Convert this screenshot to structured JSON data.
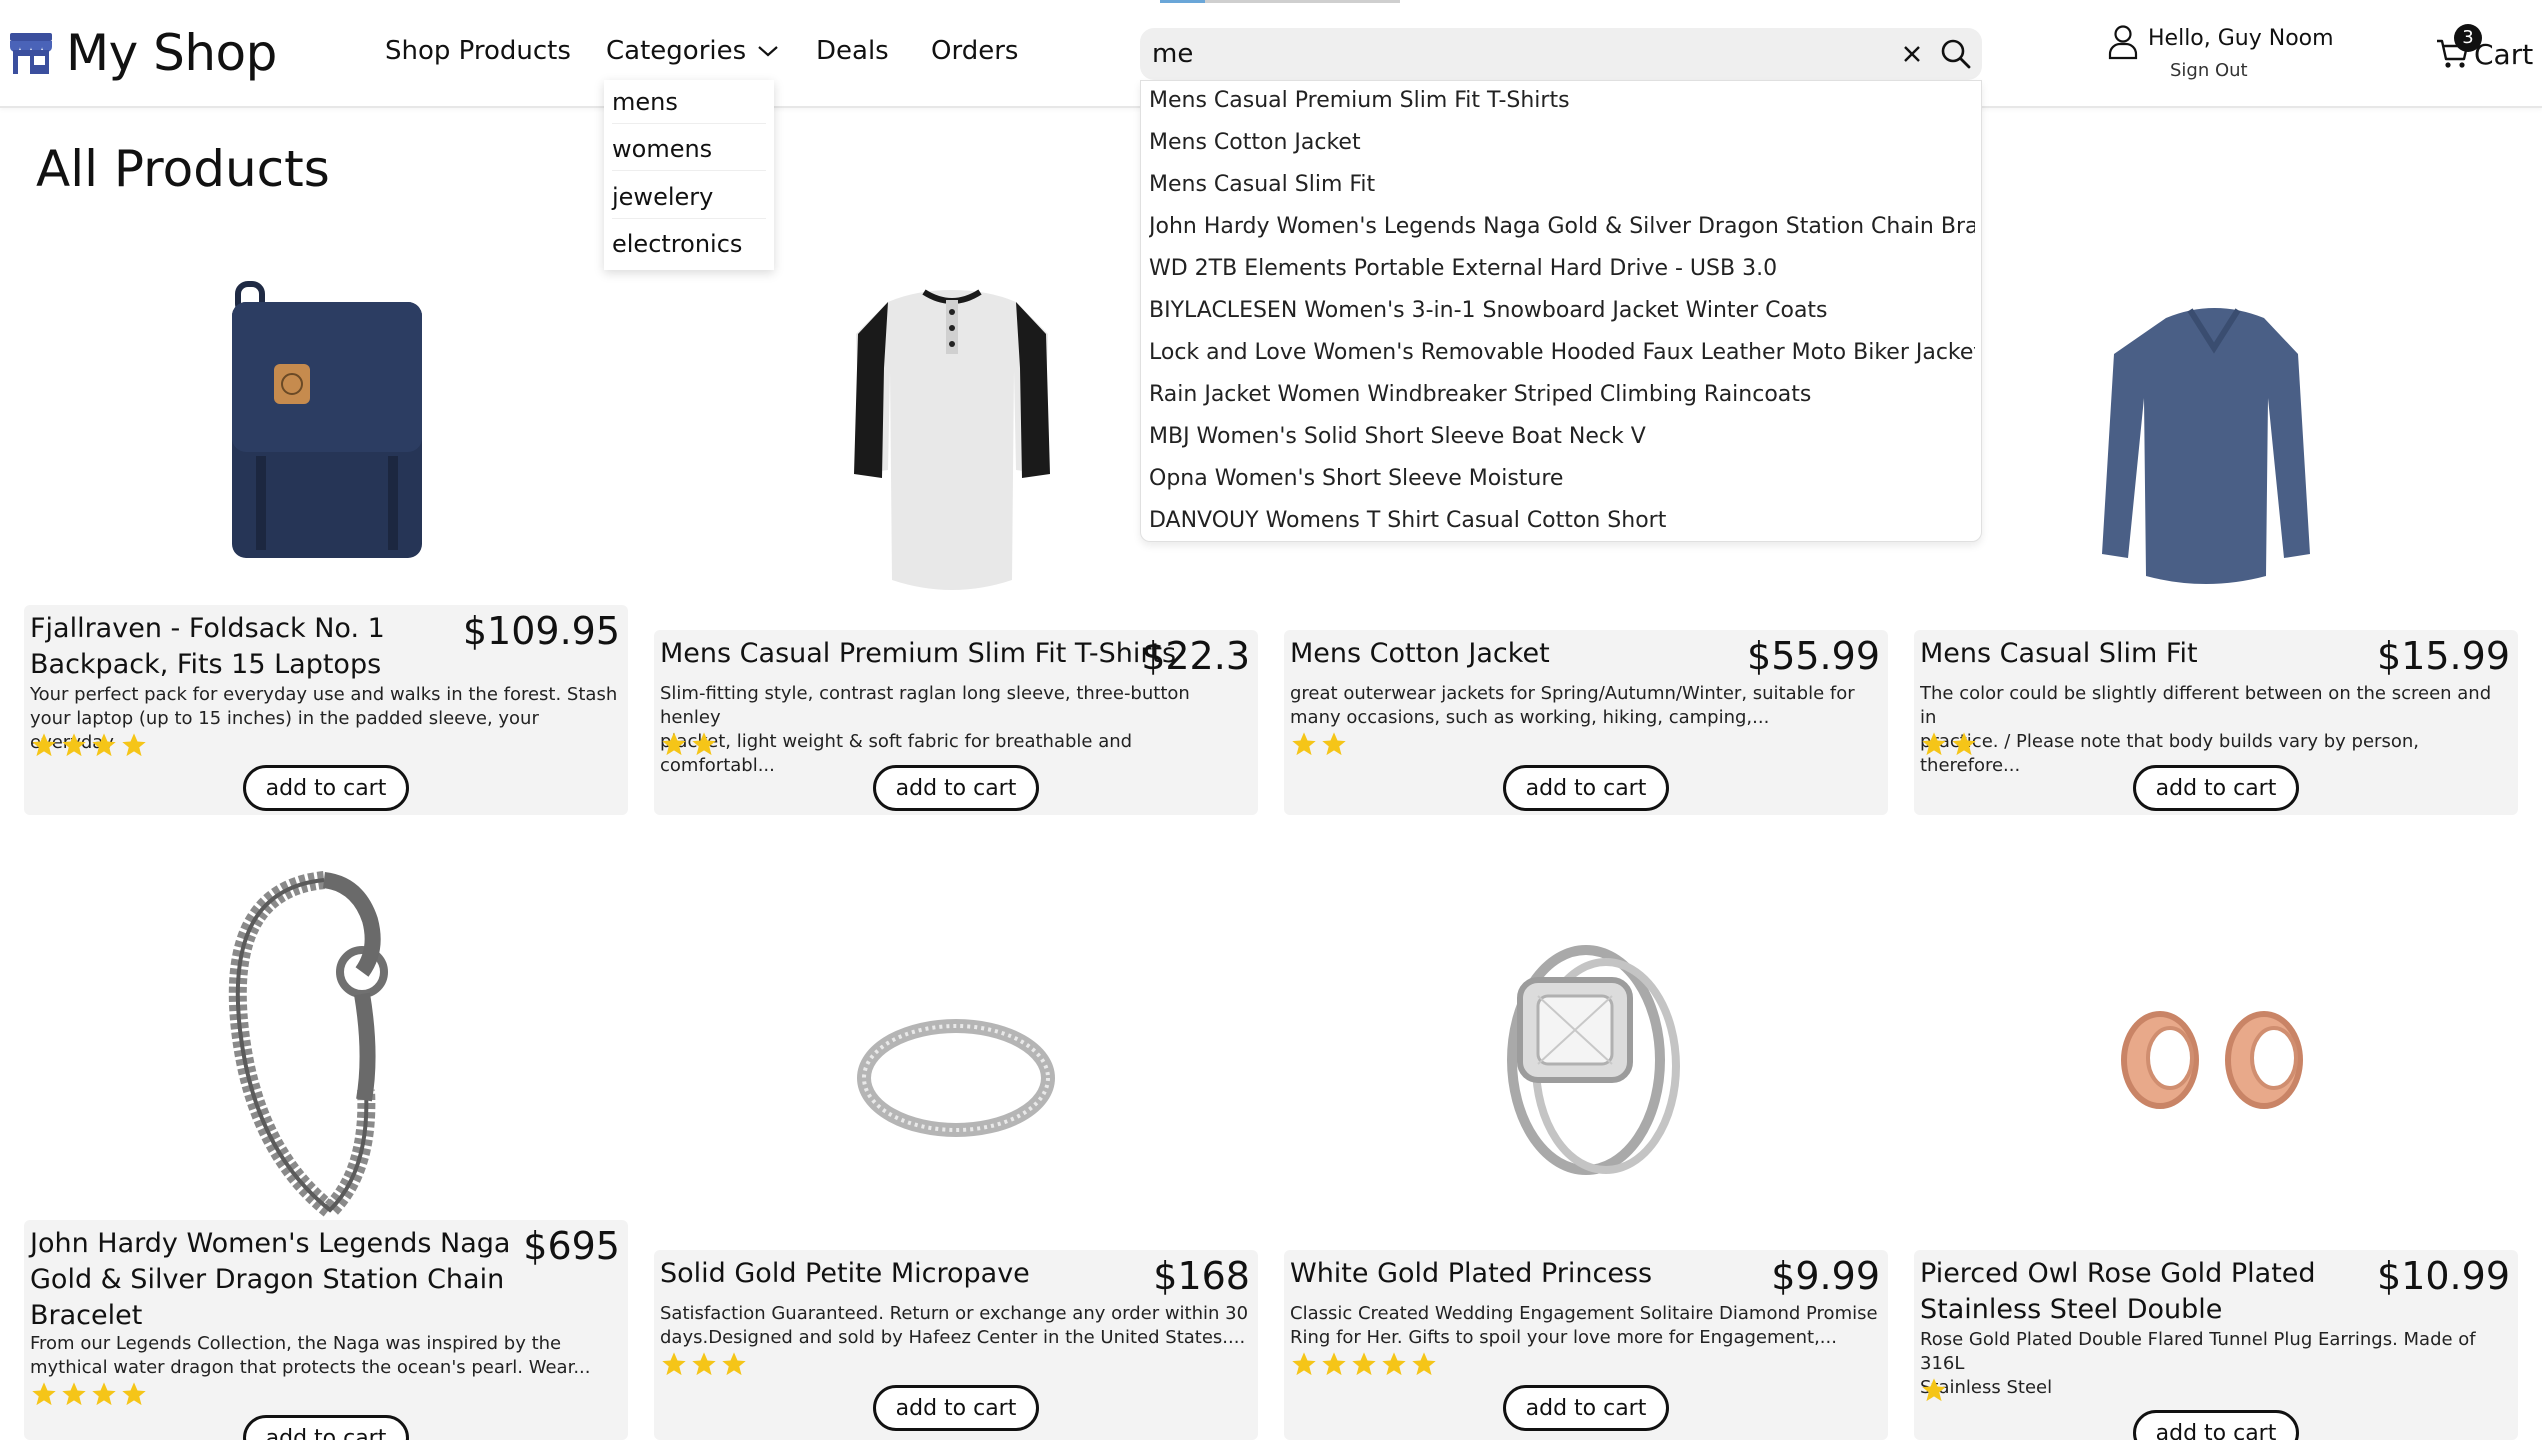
{
  "header": {
    "logo_text": "My Shop",
    "logo_icon": "storefront-icon",
    "nav": {
      "shop_products": "Shop Products",
      "categories": "Categories",
      "deals": "Deals",
      "orders": "Orders"
    },
    "search": {
      "value": "me",
      "suggestions": [
        "Mens Casual Premium Slim Fit T-Shirts",
        "Mens Cotton Jacket",
        "Mens Casual Slim Fit",
        "John Hardy Women's Legends Naga Gold & Silver Dragon Station Chain Brace...",
        "WD 2TB Elements Portable External Hard Drive - USB 3.0",
        "BIYLACLESEN Women's 3-in-1 Snowboard Jacket Winter Coats",
        "Lock and Love Women's Removable Hooded Faux Leather Moto Biker Jacket",
        "Rain Jacket Women Windbreaker Striped Climbing Raincoats",
        "MBJ Women's Solid Short Sleeve Boat Neck V",
        "Opna Women's Short Sleeve Moisture",
        "DANVOUY Womens T Shirt Casual Cotton Short"
      ]
    },
    "user": {
      "greeting": "Hello, Guy Noom",
      "sign_out": "Sign Out"
    },
    "cart": {
      "count": "3",
      "label": "Cart"
    },
    "categories_menu": [
      "mens",
      "womens",
      "jewelery",
      "electronics"
    ]
  },
  "main": {
    "title": "All Products",
    "add_label": "add to cart",
    "products": [
      {
        "name_lines": [
          "Fjallraven - Foldsack No. 1",
          "Backpack, Fits 15 Laptops"
        ],
        "price": "$109.95",
        "desc_lines": [
          "Your perfect pack for everyday use and walks in the forest. Stash",
          "your laptop (up to 15 inches) in the padded sleeve, your everyday"
        ],
        "stars": 4,
        "image": "backpack"
      },
      {
        "name_lines": [
          "Mens Casual Premium Slim Fit T-Shirts"
        ],
        "price": "$22.3",
        "desc_lines": [
          "Slim-fitting style, contrast raglan long sleeve, three-button henley",
          "placket, light weight & soft fabric for breathable and comfortabl..."
        ],
        "stars": 2,
        "image": "henley-shirt"
      },
      {
        "name_lines": [
          "Mens Cotton Jacket"
        ],
        "price": "$55.99",
        "desc_lines": [
          "great outerwear jackets for Spring/Autumn/Winter, suitable for",
          "many occasions, such as working, hiking, camping,..."
        ],
        "stars": 2,
        "image": "jacket"
      },
      {
        "name_lines": [
          "Mens Casual Slim Fit"
        ],
        "price": "$15.99",
        "desc_lines": [
          "The color could be slightly different between on the screen and in",
          "practice. / Please note that body builds vary by person, therefore..."
        ],
        "stars": 2,
        "image": "blue-longsleeve"
      },
      {
        "name_lines": [
          "John Hardy Women's Legends Naga",
          "Gold & Silver Dragon Station Chain",
          "Bracelet"
        ],
        "price": "$695",
        "desc_lines": [
          "From our Legends Collection, the Naga was inspired by the",
          "mythical water dragon that protects the ocean's pearl. Wear..."
        ],
        "stars": 4,
        "image": "dragon-bracelet"
      },
      {
        "name_lines": [
          "Solid Gold Petite Micropave"
        ],
        "price": "$168",
        "desc_lines": [
          "Satisfaction Guaranteed. Return or exchange any order within 30",
          "days.Designed and sold by Hafeez Center in the United States...."
        ],
        "stars": 3,
        "image": "thin-ring"
      },
      {
        "name_lines": [
          "White Gold Plated Princess"
        ],
        "price": "$9.99",
        "desc_lines": [
          "Classic Created Wedding Engagement Solitaire Diamond Promise",
          "Ring for Her. Gifts to spoil your love more for Engagement,..."
        ],
        "stars": 5,
        "image": "diamond-ring"
      },
      {
        "name_lines": [
          "Pierced Owl Rose Gold Plated",
          "Stainless Steel Double"
        ],
        "price": "$10.99",
        "desc_lines": [
          "Rose Gold Plated Double Flared Tunnel Plug Earrings. Made of 316L",
          "Stainless Steel"
        ],
        "stars": 1,
        "image": "rose-gold-plugs"
      }
    ]
  },
  "colors": {
    "star": "#f5c518",
    "logo_blue": "#3b4f9e",
    "card_bg": "#f3f3f3",
    "search_bg": "#efefef"
  }
}
